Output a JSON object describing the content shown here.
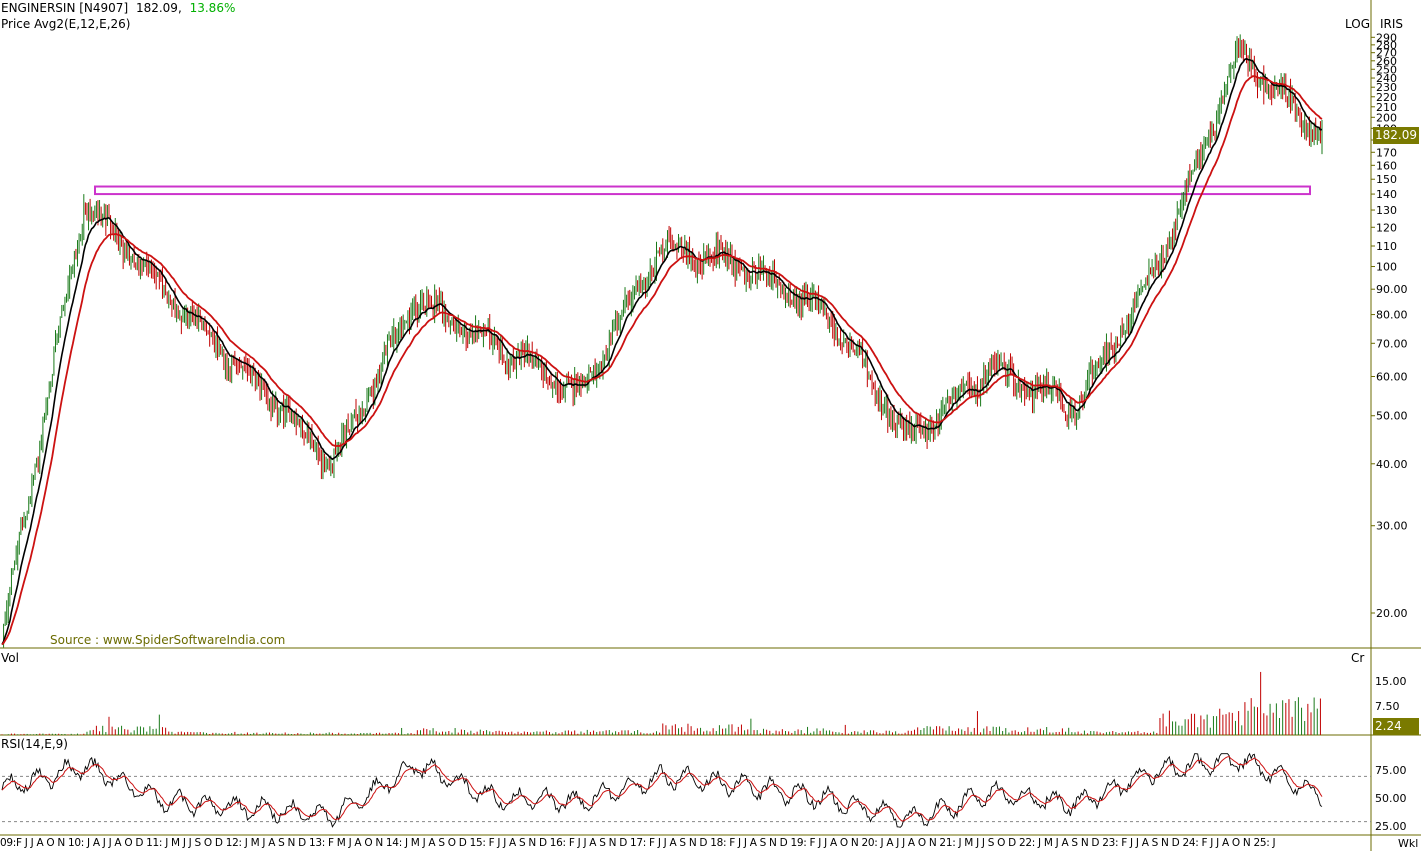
{
  "header": {
    "symbol": "ENGINERSIN [N4907]",
    "price": "182.09,",
    "change": "13.86%",
    "indicator": "Price  Avg2(E,12,E,26)",
    "scale_mode": "LOG",
    "scale_name": "IRIS"
  },
  "source_note": "Source : www.SpiderSoftwareIndia.com",
  "volume_panel": {
    "label": "Vol",
    "unit": "Cr",
    "ticks": [
      "15.00",
      "7.50"
    ],
    "last_value": "2.24"
  },
  "rsi_panel": {
    "label": "RSI(14,E,9)",
    "ticks": [
      "75.00",
      "50.00",
      "25.00"
    ],
    "overbought": 70,
    "oversold": 30
  },
  "x_axis_text": "09:F J J A O N 10: J A J J A O D 11: J M J J S O D 12: J M J A S N D 13: F M J A O N 14: J M J A S O D 15: F J J A S N D 16: F J J A S N D 17: F J J A S N D 18: F J J A S N D 19: F J J A O N 20: J A J J A O N 21: J M J J S O D 22: J M J A S N D 23: F J J A S N D 24: F J J A O N 25: J",
  "x_axis_end_label": "Wkl",
  "colors": {
    "up": "#1a7a1a",
    "down": "#c00000",
    "ema12": "#000000",
    "ema26": "#cc1111",
    "resistance": "#cc33cc",
    "last_tag": "#7a7a00",
    "green_text": "#00b000"
  },
  "chart_data": [
    {
      "type": "line",
      "title": "ENGINERSIN [N4907]",
      "scale": "log",
      "ylim": [
        17,
        300
      ],
      "y_ticks": [
        20,
        30,
        40,
        50,
        60,
        70,
        80,
        90,
        100,
        110,
        120,
        130,
        140,
        150,
        160,
        170,
        180,
        190,
        200,
        210,
        220,
        230,
        240,
        250,
        260,
        270,
        280,
        290
      ],
      "last_price": 182.09,
      "resistance_zone": [
        140,
        145
      ],
      "series": [
        {
          "name": "Price",
          "x": [
            "2009",
            "2010",
            "2011",
            "2012",
            "2013",
            "2014",
            "2015",
            "2016",
            "2017",
            "2018",
            "2019",
            "2020",
            "2021",
            "2022",
            "2023",
            "2024",
            "2025"
          ],
          "values": [
            18,
            135,
            88,
            60,
            40,
            85,
            70,
            55,
            110,
            100,
            80,
            45,
            62,
            52,
            100,
            270,
            182
          ]
        },
        {
          "name": "Avg2(E,12,E,26)",
          "x": [
            "2009",
            "2010",
            "2011",
            "2012",
            "2013",
            "2014",
            "2015",
            "2016",
            "2017",
            "2018",
            "2019",
            "2020",
            "2021",
            "2022",
            "2023",
            "2024",
            "2025"
          ],
          "values": [
            20,
            90,
            88,
            62,
            45,
            78,
            72,
            58,
            102,
            110,
            86,
            55,
            60,
            55,
            80,
            230,
            180
          ]
        }
      ]
    },
    {
      "type": "bar",
      "title": "Vol",
      "ylim": [
        0,
        17
      ],
      "x": [
        "2009",
        "2010",
        "2011",
        "2012",
        "2013",
        "2014",
        "2015",
        "2016",
        "2017",
        "2018",
        "2019",
        "2020",
        "2021",
        "2022",
        "2023",
        "2024",
        "2025"
      ],
      "values": [
        0.3,
        2.0,
        0.8,
        0.6,
        0.5,
        1.5,
        1.0,
        1.2,
        2.5,
        1.4,
        1.0,
        2.0,
        1.8,
        1.0,
        6.0,
        8.0,
        2.24
      ],
      "last_value": 2.24
    },
    {
      "type": "line",
      "title": "RSI(14,E,9)",
      "ylim": [
        20,
        95
      ],
      "x": [
        "2009",
        "2010",
        "2011",
        "2012",
        "2013",
        "2014",
        "2015",
        "2016",
        "2017",
        "2018",
        "2019",
        "2020",
        "2021",
        "2022",
        "2023",
        "2024",
        "2025"
      ],
      "series": [
        {
          "name": "RSI(14,E,9)",
          "values": [
            60,
            78,
            48,
            42,
            35,
            80,
            50,
            48,
            70,
            62,
            50,
            32,
            55,
            45,
            75,
            85,
            52
          ]
        }
      ]
    }
  ]
}
